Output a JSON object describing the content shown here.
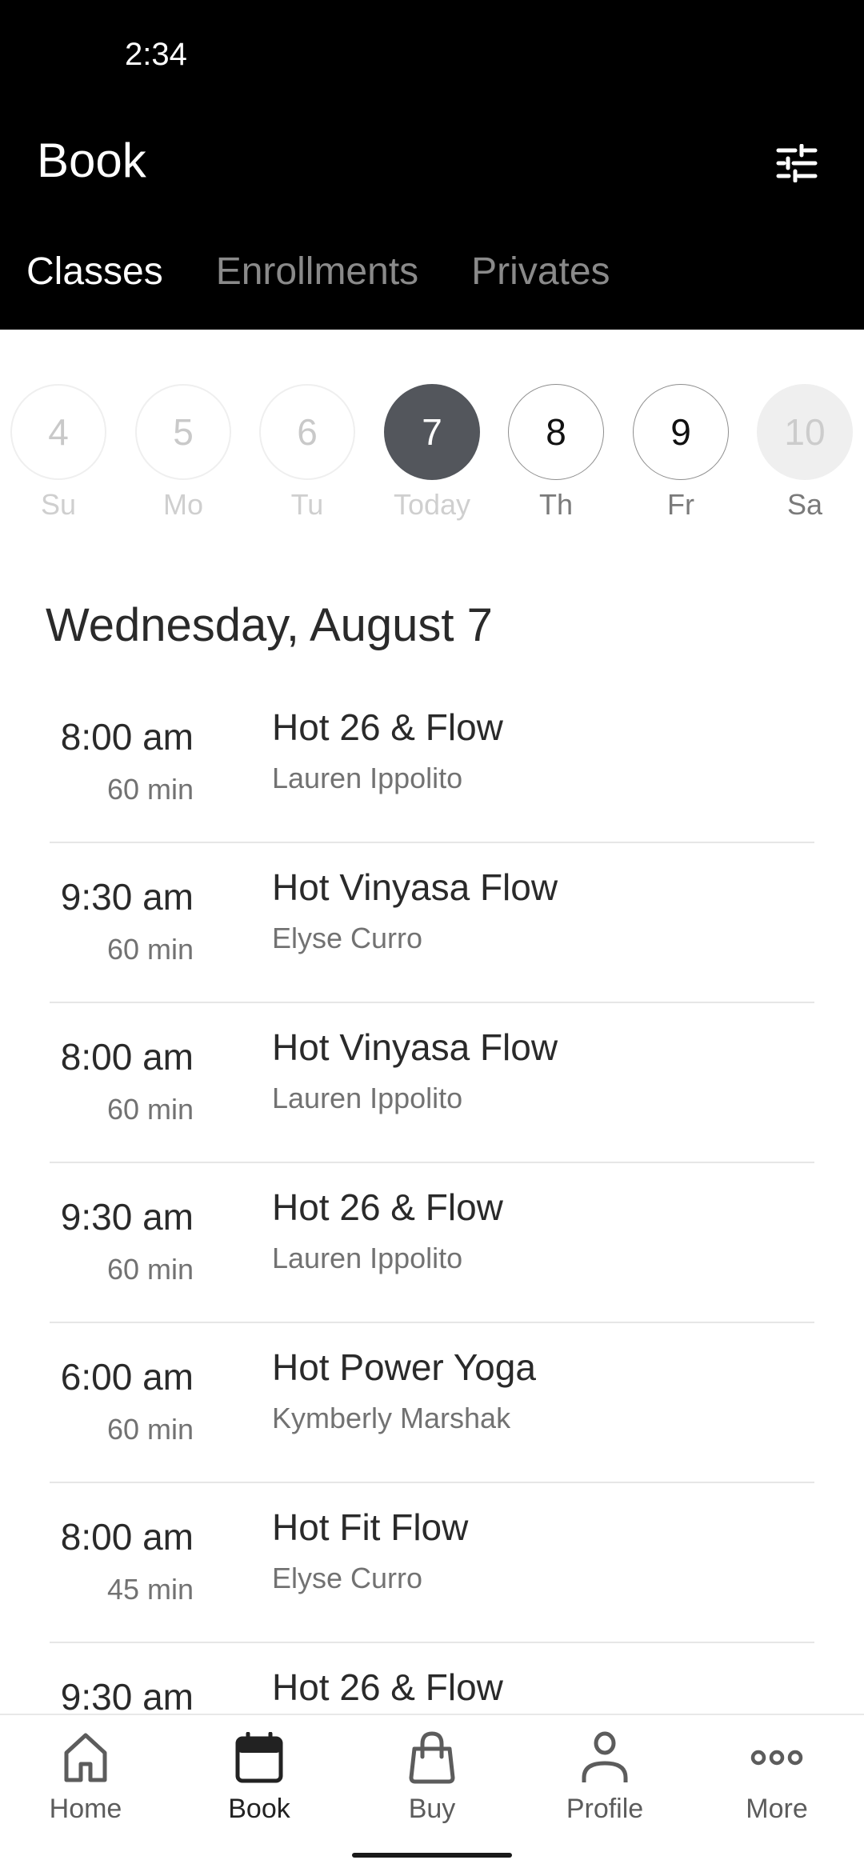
{
  "status_bar": {
    "time": "2:34"
  },
  "header": {
    "title": "Book",
    "filter_icon": "sliders-icon"
  },
  "tabs": [
    {
      "label": "Classes",
      "active": true
    },
    {
      "label": "Enrollments",
      "active": false
    },
    {
      "label": "Privates",
      "active": false
    }
  ],
  "date_strip": [
    {
      "number": "4",
      "label": "Su",
      "state": "past"
    },
    {
      "number": "5",
      "label": "Mo",
      "state": "past"
    },
    {
      "number": "6",
      "label": "Tu",
      "state": "past"
    },
    {
      "number": "7",
      "label": "Today",
      "state": "selected"
    },
    {
      "number": "8",
      "label": "Th",
      "state": "future"
    },
    {
      "number": "9",
      "label": "Fr",
      "state": "future"
    },
    {
      "number": "10",
      "label": "Sa",
      "state": "disabled"
    }
  ],
  "date_heading": "Wednesday, August 7",
  "classes": [
    {
      "time": "8:00 am",
      "duration": "60 min",
      "name": "Hot 26 & Flow",
      "instructor": "Lauren Ippolito"
    },
    {
      "time": "9:30 am",
      "duration": "60 min",
      "name": "Hot Vinyasa Flow",
      "instructor": "Elyse Curro"
    },
    {
      "time": "8:00 am",
      "duration": "60 min",
      "name": "Hot Vinyasa Flow",
      "instructor": "Lauren Ippolito"
    },
    {
      "time": "9:30 am",
      "duration": "60 min",
      "name": "Hot 26 & Flow",
      "instructor": "Lauren Ippolito"
    },
    {
      "time": "6:00 am",
      "duration": "60 min",
      "name": "Hot Power Yoga",
      "instructor": "Kymberly Marshak"
    },
    {
      "time": "8:00 am",
      "duration": "45 min",
      "name": "Hot Fit Flow",
      "instructor": "Elyse Curro"
    },
    {
      "time": "9:30 am",
      "duration": "",
      "name": "Hot 26 & Flow",
      "instructor": ""
    }
  ],
  "bottom_nav": [
    {
      "label": "Home",
      "icon": "home-icon",
      "active": false
    },
    {
      "label": "Book",
      "icon": "calendar-icon",
      "active": true
    },
    {
      "label": "Buy",
      "icon": "shopping-bag-icon",
      "active": false
    },
    {
      "label": "Profile",
      "icon": "person-icon",
      "active": false
    },
    {
      "label": "More",
      "icon": "more-dots-icon",
      "active": false
    }
  ],
  "colors": {
    "header_bg": "#000000",
    "selected_day": "#53565c",
    "text_primary": "#2a2a2a",
    "text_secondary": "#727272"
  }
}
